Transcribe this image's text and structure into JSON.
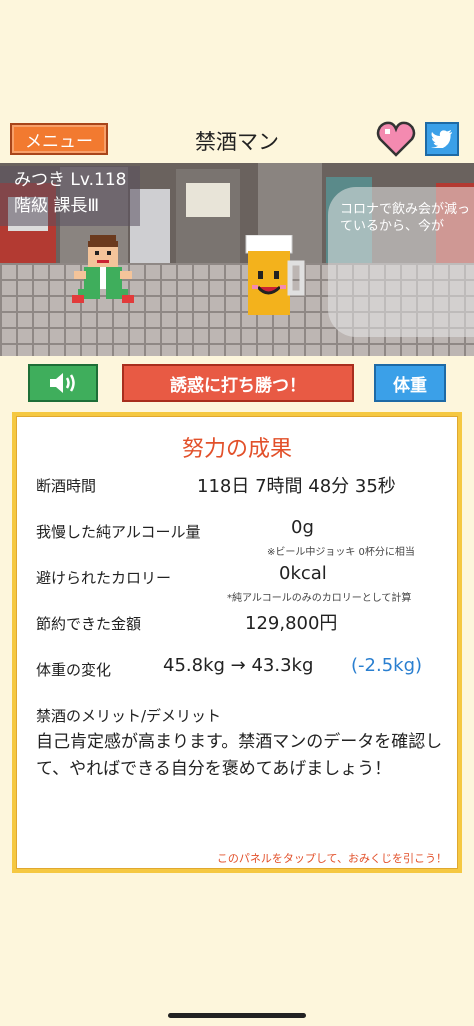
{
  "header": {
    "menu_label": "メニュー",
    "title": "禁酒マン"
  },
  "scene": {
    "player_name": "みつき Lv.118",
    "player_rank": "階級 課長Ⅲ",
    "bubble_text": "コロナで飲み会が減っているから、今が"
  },
  "actions": {
    "tempt_label": "誘惑に打ち勝つ！",
    "weight_label": "体重"
  },
  "panel": {
    "title": "努力の成果",
    "abstinence_label": "断酒時間",
    "abstinence_value": "118日 7時間 48分 35秒",
    "alcohol_label": "我慢した純アルコール量",
    "alcohol_value": "0g",
    "alcohol_note": "※ビール中ジョッキ 0杯分に相当",
    "calorie_label": "避けられたカロリー",
    "calorie_value": "0kcal",
    "calorie_note": "*純アルコールのみのカロリーとして計算",
    "money_label": "節約できた金額",
    "money_value": "129,800円",
    "weight_label": "体重の変化",
    "weight_value": "45.8kg → 43.3kg",
    "weight_diff": "(-2.5kg)",
    "merit_label": "禁酒のメリット/デメリット",
    "merit_text": "自己肯定感が高まります。禁酒マンのデータを確認して、やればできる自分を褒めてあげましょう！",
    "omikuji_hint": "このパネルをタップして、おみくじを引こう！"
  },
  "colors": {
    "background": "#fdf6dc",
    "menu_button": "#f27a30",
    "tempt_button": "#e85a44",
    "weight_button": "#3ba0e8",
    "sound_button": "#3fae5c",
    "panel_border": "#f5c842",
    "accent_text": "#e2502a",
    "weight_diff": "#2a7fd0"
  },
  "icons": {
    "heart": "heart-icon",
    "twitter": "twitter-bird-icon",
    "sound": "speaker-icon"
  }
}
